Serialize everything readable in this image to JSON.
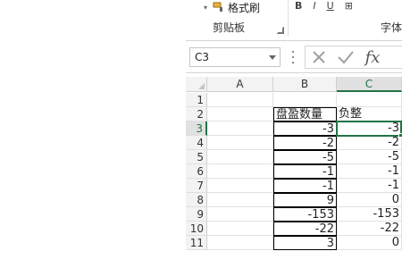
{
  "ribbon": {
    "format_painter_label": "格式刷",
    "clipboard_group_label": "剪贴板",
    "font_group_label": "字体",
    "font_buttons": [
      "B",
      "I",
      "U",
      "⊞"
    ]
  },
  "formula_bar": {
    "name_box": "C3",
    "fx_label": "fx",
    "formula_value": ""
  },
  "grid": {
    "columns": [
      "A",
      "B",
      "C"
    ],
    "selected_column": "C",
    "rows": [
      "1",
      "2",
      "3",
      "4",
      "5",
      "6",
      "7",
      "8",
      "9",
      "10",
      "11"
    ],
    "selected_row": "3",
    "header_row": {
      "B": "盘盈数量",
      "C": "负整"
    },
    "data": [
      {
        "row": "3",
        "B": "-3",
        "C": "-3"
      },
      {
        "row": "4",
        "B": "-2",
        "C": "-2"
      },
      {
        "row": "5",
        "B": "-5",
        "C": "-5"
      },
      {
        "row": "6",
        "B": "-1",
        "C": "-1"
      },
      {
        "row": "7",
        "B": "-1",
        "C": "-1"
      },
      {
        "row": "8",
        "B": "9",
        "C": "0"
      },
      {
        "row": "9",
        "B": "-153",
        "C": "-153"
      },
      {
        "row": "10",
        "B": "-22",
        "C": "-22"
      },
      {
        "row": "11",
        "B": "3",
        "C": "0"
      }
    ],
    "accent_color": "#217346"
  }
}
